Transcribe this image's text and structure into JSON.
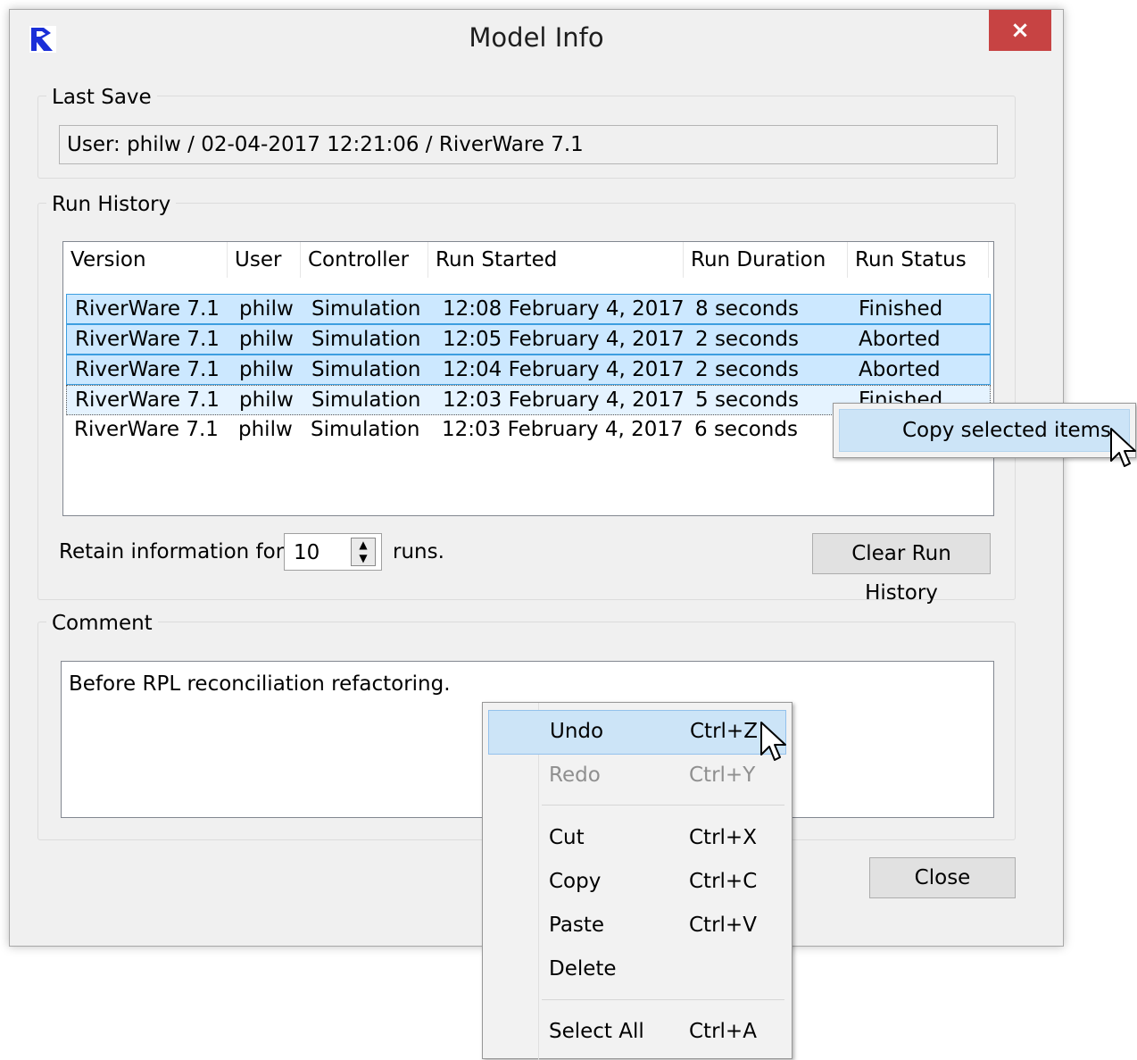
{
  "window": {
    "title": "Model Info",
    "close_glyph": "×",
    "logo_icon": "riverware-logo-icon",
    "close_color": "#c74343"
  },
  "last_save": {
    "label": "Last Save",
    "value": "User: philw / 02-04-2017 12:21:06 / RiverWare 7.1"
  },
  "run_history": {
    "label": "Run History",
    "columns": [
      "Version",
      "User",
      "Controller",
      "Run Started",
      "Run Duration",
      "Run Status"
    ],
    "rows": [
      {
        "version": "RiverWare 7.1",
        "user": "philw",
        "controller": "Simulation",
        "started": "12:08 February 4, 2017",
        "duration": "8 seconds",
        "status": "Finished",
        "state": "selected"
      },
      {
        "version": "RiverWare 7.1",
        "user": "philw",
        "controller": "Simulation",
        "started": "12:05 February 4, 2017",
        "duration": "2 seconds",
        "status": "Aborted",
        "state": "selected"
      },
      {
        "version": "RiverWare 7.1",
        "user": "philw",
        "controller": "Simulation",
        "started": "12:04 February 4, 2017",
        "duration": "2 seconds",
        "status": "Aborted",
        "state": "selected"
      },
      {
        "version": "RiverWare 7.1",
        "user": "philw",
        "controller": "Simulation",
        "started": "12:03 February 4, 2017",
        "duration": "5 seconds",
        "status": "Finished",
        "state": "focused"
      },
      {
        "version": "RiverWare 7.1",
        "user": "philw",
        "controller": "Simulation",
        "started": "12:03 February 4, 2017",
        "duration": "6 seconds",
        "status": "",
        "state": "normal"
      }
    ],
    "retain_label": "Retain information for",
    "retain_value": "10",
    "runs_label": "runs.",
    "clear_button": "Clear Run History",
    "selection_color": "#cce8ff"
  },
  "comment": {
    "label": "Comment",
    "text": "Before RPL reconciliation refactoring."
  },
  "close_button": "Close",
  "copy_menu": {
    "item": "Copy selected items"
  },
  "edit_menu": {
    "items": [
      {
        "label": "Undo",
        "shortcut": "Ctrl+Z",
        "enabled": true,
        "highlighted": true
      },
      {
        "label": "Redo",
        "shortcut": "Ctrl+Y",
        "enabled": false
      },
      {
        "label": "Cut",
        "shortcut": "Ctrl+X",
        "enabled": true
      },
      {
        "label": "Copy",
        "shortcut": "Ctrl+C",
        "enabled": true
      },
      {
        "label": "Paste",
        "shortcut": "Ctrl+V",
        "enabled": true
      },
      {
        "label": "Delete",
        "shortcut": "",
        "enabled": true
      },
      {
        "label": "Select All",
        "shortcut": "Ctrl+A",
        "enabled": true
      }
    ]
  }
}
